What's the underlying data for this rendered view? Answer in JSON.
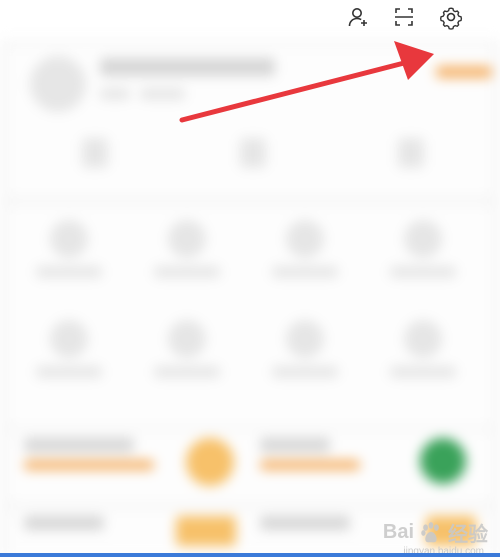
{
  "topbar": {
    "icons": [
      {
        "name": "add-contact-icon"
      },
      {
        "name": "scan-icon"
      },
      {
        "name": "settings-gear-icon"
      }
    ]
  },
  "annotation": {
    "arrow_color": "#e8383d",
    "points_to": "settings-gear-icon"
  },
  "watermark": {
    "text_left": "Bai",
    "text_right": "经验",
    "sub": "jingyan.baidu.com"
  },
  "colors": {
    "accent_orange": "#f5b36b",
    "bottom_bar": "#3b7ad9"
  }
}
